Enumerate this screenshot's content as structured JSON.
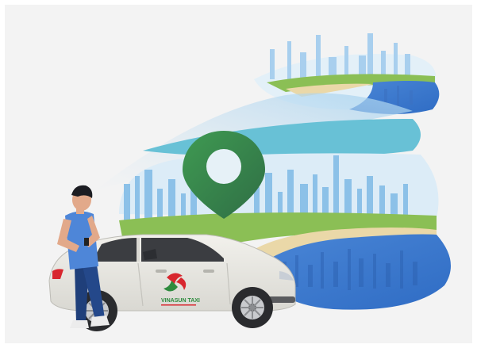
{
  "illustration": {
    "logo_text": "VINASUN TAXI",
    "colors": {
      "background": "#f3f3f3",
      "sky": "#cfe4f3",
      "skyline": "#8cc1e8",
      "grass": "#8bbf55",
      "sand": "#ead8a8",
      "water_dark": "#3f7fd1",
      "water_light": "#6aa9e6",
      "pin_green": "#3f8e4c",
      "car_body": "#ecebe6",
      "brand_red": "#d8262e",
      "brand_green": "#2e8b3e",
      "shirt": "#4e86d8",
      "jeans": "#1f3f7a"
    }
  }
}
